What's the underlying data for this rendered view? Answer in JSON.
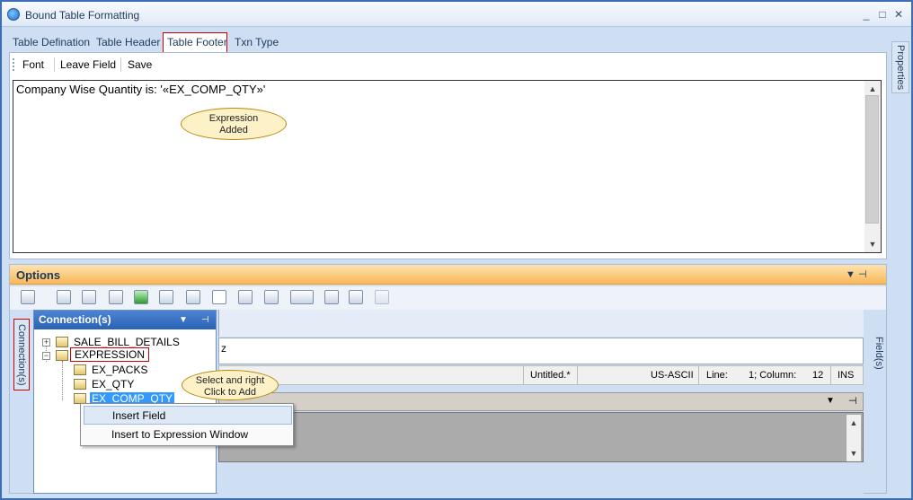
{
  "window": {
    "title": "Bound Table Formatting",
    "min": "_",
    "max": "□",
    "close": "✕"
  },
  "tabs": [
    {
      "label": "Table Defination"
    },
    {
      "label": "Table Header"
    },
    {
      "label": "Table Footer"
    },
    {
      "label": "Txn Type"
    }
  ],
  "editor_toolbar": {
    "font": "Font",
    "leave_field": "Leave Field",
    "save": "Save"
  },
  "editor": {
    "text": "Company Wise Quantity is: '«EX_COMP_QTY»'"
  },
  "callouts": {
    "expression": "Expression\nAdded",
    "select": "Select and right\nClick to Add"
  },
  "properties_tab": "Properties",
  "options": {
    "title": "Options",
    "pin": "▼  ⊣"
  },
  "connections": {
    "tab_label": "Connection(s)",
    "header": "Connection(s)",
    "tree": [
      {
        "label": "SALE_BILL_DETAILS",
        "expander": "+"
      },
      {
        "label": "EXPRESSION",
        "expander": "−"
      },
      {
        "label": "EX_PACKS"
      },
      {
        "label": "EX_QTY"
      },
      {
        "label": "EX_COMP_QTY"
      }
    ]
  },
  "fields_tab": "Field(s)",
  "status": {
    "file": "Untitled.*",
    "encoding": "US-ASCII",
    "line_label": "Line:",
    "line_value": "1; Column:",
    "col_value": "12",
    "mode": "INS"
  },
  "code_fragment": "z",
  "context_menu": [
    {
      "label": "Insert Field"
    },
    {
      "label": "Insert to Expression Window"
    }
  ]
}
